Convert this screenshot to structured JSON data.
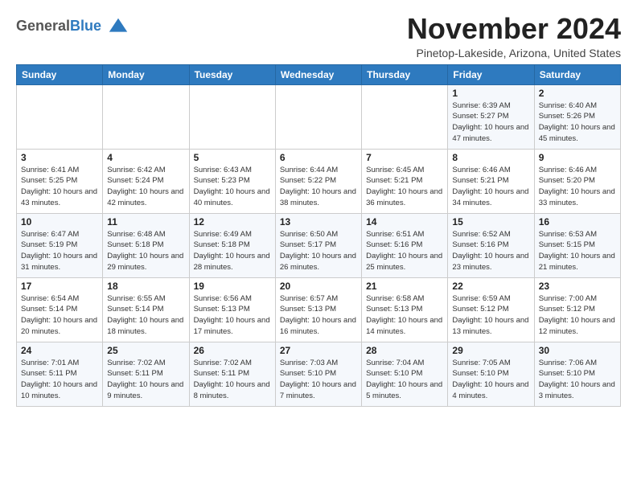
{
  "header": {
    "logo_general": "General",
    "logo_blue": "Blue",
    "month_title": "November 2024",
    "subtitle": "Pinetop-Lakeside, Arizona, United States"
  },
  "weekdays": [
    "Sunday",
    "Monday",
    "Tuesday",
    "Wednesday",
    "Thursday",
    "Friday",
    "Saturday"
  ],
  "weeks": [
    [
      {
        "day": "",
        "info": ""
      },
      {
        "day": "",
        "info": ""
      },
      {
        "day": "",
        "info": ""
      },
      {
        "day": "",
        "info": ""
      },
      {
        "day": "",
        "info": ""
      },
      {
        "day": "1",
        "info": "Sunrise: 6:39 AM\nSunset: 5:27 PM\nDaylight: 10 hours and 47 minutes."
      },
      {
        "day": "2",
        "info": "Sunrise: 6:40 AM\nSunset: 5:26 PM\nDaylight: 10 hours and 45 minutes."
      }
    ],
    [
      {
        "day": "3",
        "info": "Sunrise: 6:41 AM\nSunset: 5:25 PM\nDaylight: 10 hours and 43 minutes."
      },
      {
        "day": "4",
        "info": "Sunrise: 6:42 AM\nSunset: 5:24 PM\nDaylight: 10 hours and 42 minutes."
      },
      {
        "day": "5",
        "info": "Sunrise: 6:43 AM\nSunset: 5:23 PM\nDaylight: 10 hours and 40 minutes."
      },
      {
        "day": "6",
        "info": "Sunrise: 6:44 AM\nSunset: 5:22 PM\nDaylight: 10 hours and 38 minutes."
      },
      {
        "day": "7",
        "info": "Sunrise: 6:45 AM\nSunset: 5:21 PM\nDaylight: 10 hours and 36 minutes."
      },
      {
        "day": "8",
        "info": "Sunrise: 6:46 AM\nSunset: 5:21 PM\nDaylight: 10 hours and 34 minutes."
      },
      {
        "day": "9",
        "info": "Sunrise: 6:46 AM\nSunset: 5:20 PM\nDaylight: 10 hours and 33 minutes."
      }
    ],
    [
      {
        "day": "10",
        "info": "Sunrise: 6:47 AM\nSunset: 5:19 PM\nDaylight: 10 hours and 31 minutes."
      },
      {
        "day": "11",
        "info": "Sunrise: 6:48 AM\nSunset: 5:18 PM\nDaylight: 10 hours and 29 minutes."
      },
      {
        "day": "12",
        "info": "Sunrise: 6:49 AM\nSunset: 5:18 PM\nDaylight: 10 hours and 28 minutes."
      },
      {
        "day": "13",
        "info": "Sunrise: 6:50 AM\nSunset: 5:17 PM\nDaylight: 10 hours and 26 minutes."
      },
      {
        "day": "14",
        "info": "Sunrise: 6:51 AM\nSunset: 5:16 PM\nDaylight: 10 hours and 25 minutes."
      },
      {
        "day": "15",
        "info": "Sunrise: 6:52 AM\nSunset: 5:16 PM\nDaylight: 10 hours and 23 minutes."
      },
      {
        "day": "16",
        "info": "Sunrise: 6:53 AM\nSunset: 5:15 PM\nDaylight: 10 hours and 21 minutes."
      }
    ],
    [
      {
        "day": "17",
        "info": "Sunrise: 6:54 AM\nSunset: 5:14 PM\nDaylight: 10 hours and 20 minutes."
      },
      {
        "day": "18",
        "info": "Sunrise: 6:55 AM\nSunset: 5:14 PM\nDaylight: 10 hours and 18 minutes."
      },
      {
        "day": "19",
        "info": "Sunrise: 6:56 AM\nSunset: 5:13 PM\nDaylight: 10 hours and 17 minutes."
      },
      {
        "day": "20",
        "info": "Sunrise: 6:57 AM\nSunset: 5:13 PM\nDaylight: 10 hours and 16 minutes."
      },
      {
        "day": "21",
        "info": "Sunrise: 6:58 AM\nSunset: 5:13 PM\nDaylight: 10 hours and 14 minutes."
      },
      {
        "day": "22",
        "info": "Sunrise: 6:59 AM\nSunset: 5:12 PM\nDaylight: 10 hours and 13 minutes."
      },
      {
        "day": "23",
        "info": "Sunrise: 7:00 AM\nSunset: 5:12 PM\nDaylight: 10 hours and 12 minutes."
      }
    ],
    [
      {
        "day": "24",
        "info": "Sunrise: 7:01 AM\nSunset: 5:11 PM\nDaylight: 10 hours and 10 minutes."
      },
      {
        "day": "25",
        "info": "Sunrise: 7:02 AM\nSunset: 5:11 PM\nDaylight: 10 hours and 9 minutes."
      },
      {
        "day": "26",
        "info": "Sunrise: 7:02 AM\nSunset: 5:11 PM\nDaylight: 10 hours and 8 minutes."
      },
      {
        "day": "27",
        "info": "Sunrise: 7:03 AM\nSunset: 5:10 PM\nDaylight: 10 hours and 7 minutes."
      },
      {
        "day": "28",
        "info": "Sunrise: 7:04 AM\nSunset: 5:10 PM\nDaylight: 10 hours and 5 minutes."
      },
      {
        "day": "29",
        "info": "Sunrise: 7:05 AM\nSunset: 5:10 PM\nDaylight: 10 hours and 4 minutes."
      },
      {
        "day": "30",
        "info": "Sunrise: 7:06 AM\nSunset: 5:10 PM\nDaylight: 10 hours and 3 minutes."
      }
    ]
  ]
}
